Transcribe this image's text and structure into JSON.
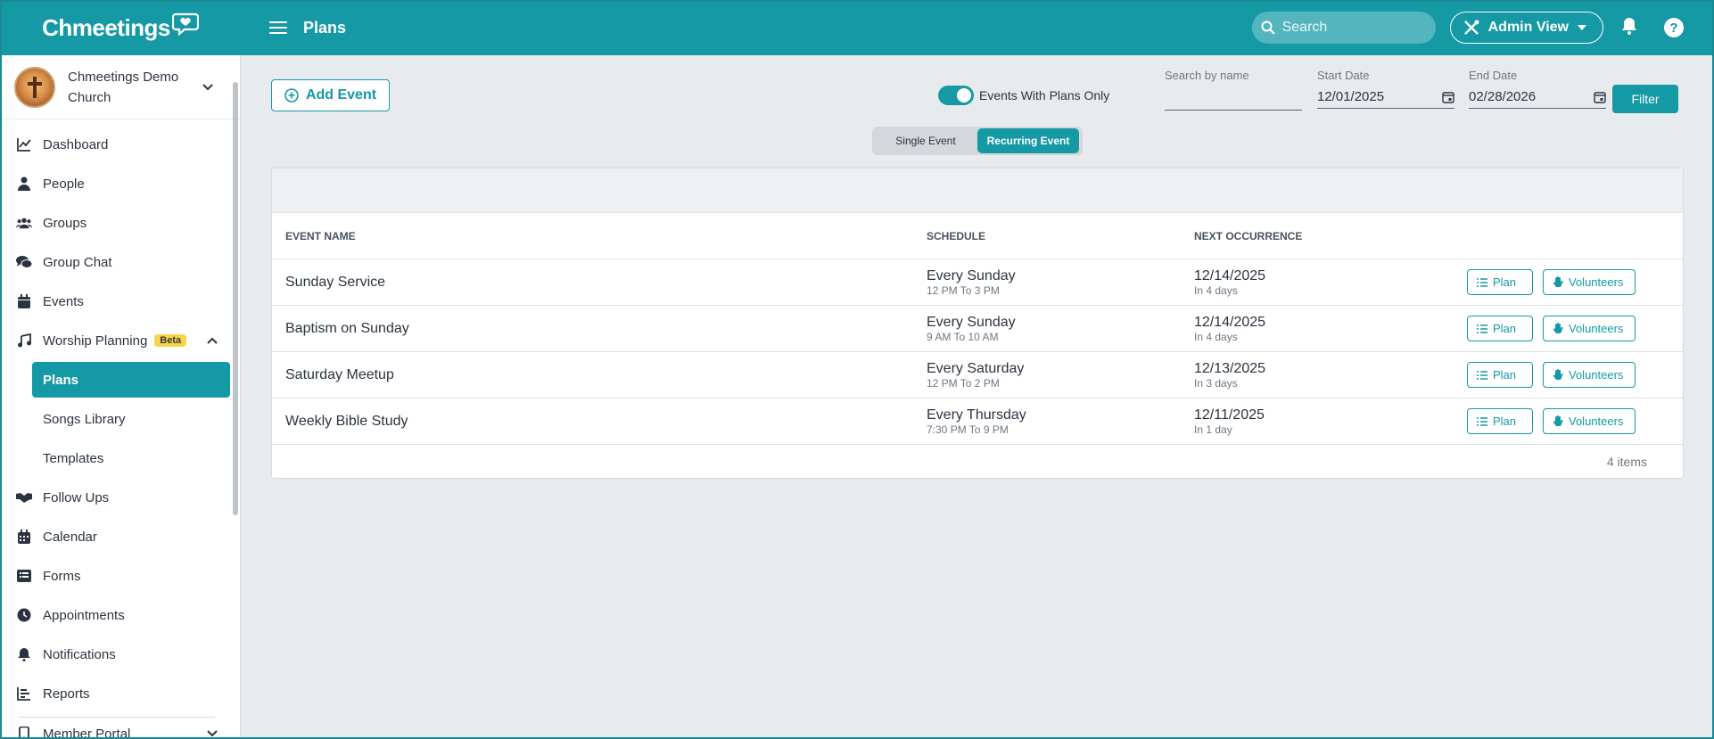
{
  "app": {
    "logo_text": "Chmeetings",
    "page_title": "Plans"
  },
  "topbar": {
    "search_placeholder": "Search",
    "admin_view_label": "Admin View",
    "help_label": "?"
  },
  "colors": {
    "primary": "#1499a5",
    "beta_badge": "#f7d54a"
  },
  "sidebar": {
    "church_name": "Chmeetings Demo Church",
    "items": [
      {
        "label": "Dashboard",
        "icon": "chart-line-icon"
      },
      {
        "label": "People",
        "icon": "person-icon"
      },
      {
        "label": "Groups",
        "icon": "users-icon"
      },
      {
        "label": "Group Chat",
        "icon": "chat-icon"
      },
      {
        "label": "Events",
        "icon": "calendar-icon"
      },
      {
        "label": "Worship Planning",
        "icon": "music-note-icon",
        "badge": "Beta"
      },
      {
        "label": "Follow Ups",
        "icon": "handshake-icon"
      },
      {
        "label": "Calendar",
        "icon": "calendar-grid-icon"
      },
      {
        "label": "Forms",
        "icon": "form-icon"
      },
      {
        "label": "Appointments",
        "icon": "clock-icon"
      },
      {
        "label": "Notifications",
        "icon": "bell-icon"
      },
      {
        "label": "Reports",
        "icon": "bar-chart-icon"
      },
      {
        "label": "Member Portal",
        "icon": "mobile-icon"
      }
    ],
    "sub_items": [
      "Plans",
      "Songs Library",
      "Templates"
    ]
  },
  "toolbar": {
    "add_event_label": "Add Event",
    "toggle_label": "Events With Plans Only",
    "toggle_on": true,
    "search_by_name_label": "Search by name",
    "search_by_name_value": "",
    "start_date_label": "Start Date",
    "start_date_value": "12/01/2025",
    "end_date_label": "End Date",
    "end_date_value": "02/28/2026",
    "filter_label": "Filter",
    "segment": {
      "single": "Single Event",
      "recurring": "Recurring Event",
      "selected": "recurring"
    }
  },
  "table": {
    "columns": [
      "EVENT NAME",
      "SCHEDULE",
      "NEXT OCCURRENCE"
    ],
    "rows": [
      {
        "name": "Sunday Service",
        "schedule": "Every Sunday",
        "time": "12 PM To 3 PM",
        "next": "12/14/2025",
        "in": "In 4 days"
      },
      {
        "name": "Baptism on Sunday",
        "schedule": "Every Sunday",
        "time": "9 AM To 10 AM",
        "next": "12/14/2025",
        "in": "In 4 days"
      },
      {
        "name": "Saturday Meetup",
        "schedule": "Every Saturday",
        "time": "12 PM To 2 PM",
        "next": "12/13/2025",
        "in": "In 3 days"
      },
      {
        "name": "Weekly Bible Study",
        "schedule": "Every Thursday",
        "time": "7:30 PM To 9 PM",
        "next": "12/11/2025",
        "in": "In 1 day"
      }
    ],
    "plan_label": "Plan",
    "volunteers_label": "Volunteers",
    "count_label": "4 items"
  }
}
